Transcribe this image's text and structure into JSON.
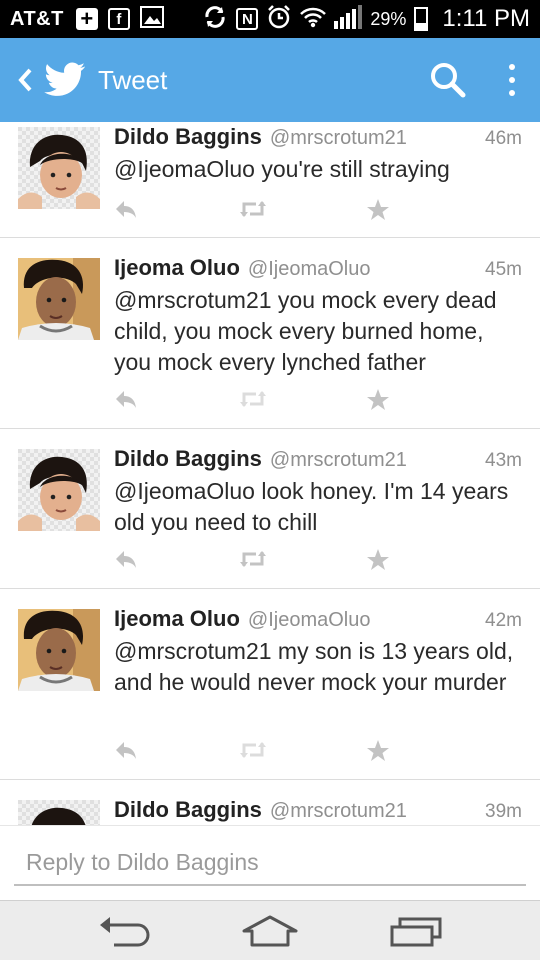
{
  "status_bar": {
    "carrier": "AT&T",
    "battery": "29%",
    "time": "1:11 PM"
  },
  "app_bar": {
    "title": "Tweet"
  },
  "tweets": [
    {
      "name": "Dildo Baggins",
      "handle": "@mrscrotum21",
      "time": "46m",
      "text": "@IjeomaOluo you're still straying"
    },
    {
      "name": "Ijeoma Oluo",
      "handle": "@IjeomaOluo",
      "time": "45m",
      "text": "@mrscrotum21 you mock every dead child, you mock every burned home, you mock every lynched father"
    },
    {
      "name": "Dildo Baggins",
      "handle": "@mrscrotum21",
      "time": "43m",
      "text": "@IjeomaOluo look honey. I'm 14 years old you need to chill"
    },
    {
      "name": "Ijeoma Oluo",
      "handle": "@IjeomaOluo",
      "time": "42m",
      "text": "@mrscrotum21 my son is 13 years old, and he would never mock your murder"
    },
    {
      "name": "Dildo Baggins",
      "handle": "@mrscrotum21",
      "time": "39m",
      "text": ""
    }
  ],
  "reply": {
    "placeholder": "Reply to Dildo Baggins"
  },
  "colors": {
    "app_bar": "#56a8e6",
    "status_bar": "#000000",
    "muted_text": "#8f8f8f"
  }
}
